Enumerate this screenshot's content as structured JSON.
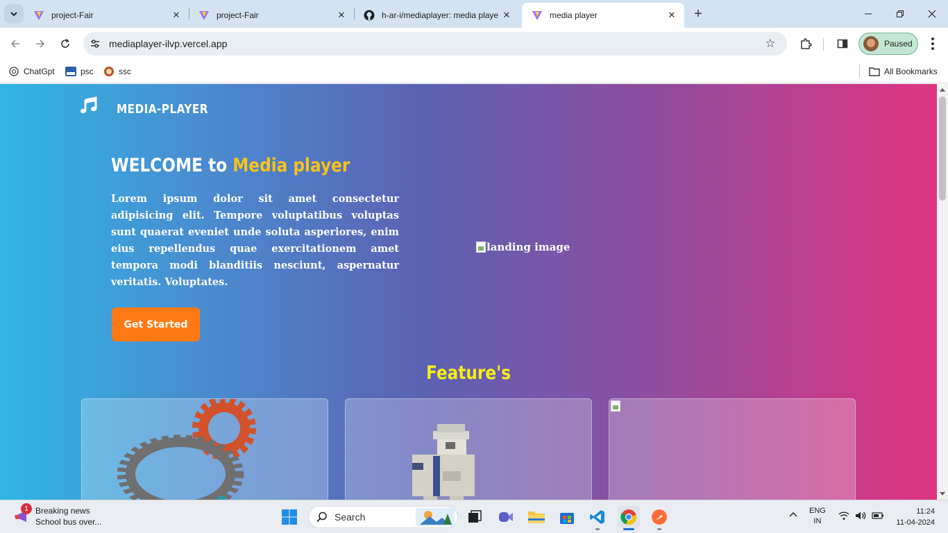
{
  "browser": {
    "tabs": [
      {
        "title": "project-Fair",
        "favicon": "vite-icon",
        "active": false
      },
      {
        "title": "project-Fair",
        "favicon": "vite-icon",
        "active": false
      },
      {
        "title": "h-ar-i/mediaplayer: media playe",
        "favicon": "github-icon",
        "active": false
      },
      {
        "title": "media player",
        "favicon": "vite-icon",
        "active": true
      }
    ],
    "url": "mediaplayer-ilvp.vercel.app",
    "profile_label": "Paused",
    "bookmarks": [
      {
        "label": "ChatGpt",
        "icon": "chatgpt-icon"
      },
      {
        "label": "psc",
        "icon": "psc-icon"
      },
      {
        "label": "ssc",
        "icon": "ssc-icon"
      }
    ],
    "all_bookmarks_label": "All Bookmarks"
  },
  "page": {
    "brand": "MEDIA-PLAYER",
    "hero_title_prefix": "WELCOME to ",
    "hero_title_highlight": "Media player",
    "hero_text": "Lorem ipsum dolor sit amet consectetur adipisicing elit. Tempore voluptatibus voluptas sunt quaerat eveniet unde soluta asperiores, enim eius repellendus quae exercitationem amet tempora modi blanditiis nesciunt, aspernatur veritatis. Voluptates.",
    "cta_label": "Get Started",
    "landing_image_alt": "landing image",
    "features_title": "Feature's",
    "feature_cards": [
      {
        "image": "gears-image"
      },
      {
        "image": "pixel-character-image"
      },
      {
        "image": "broken-image"
      }
    ],
    "colors": {
      "highlight": "#f7c21b",
      "cta": "#ff7a14",
      "features_title": "#f4ef17"
    }
  },
  "taskbar": {
    "news_title": "Breaking news",
    "news_subtitle": "School bus over...",
    "news_badge": "1",
    "search_label": "Search",
    "lang_primary": "ENG",
    "lang_secondary": "IN",
    "time": "11:24",
    "date": "11-04-2024"
  }
}
